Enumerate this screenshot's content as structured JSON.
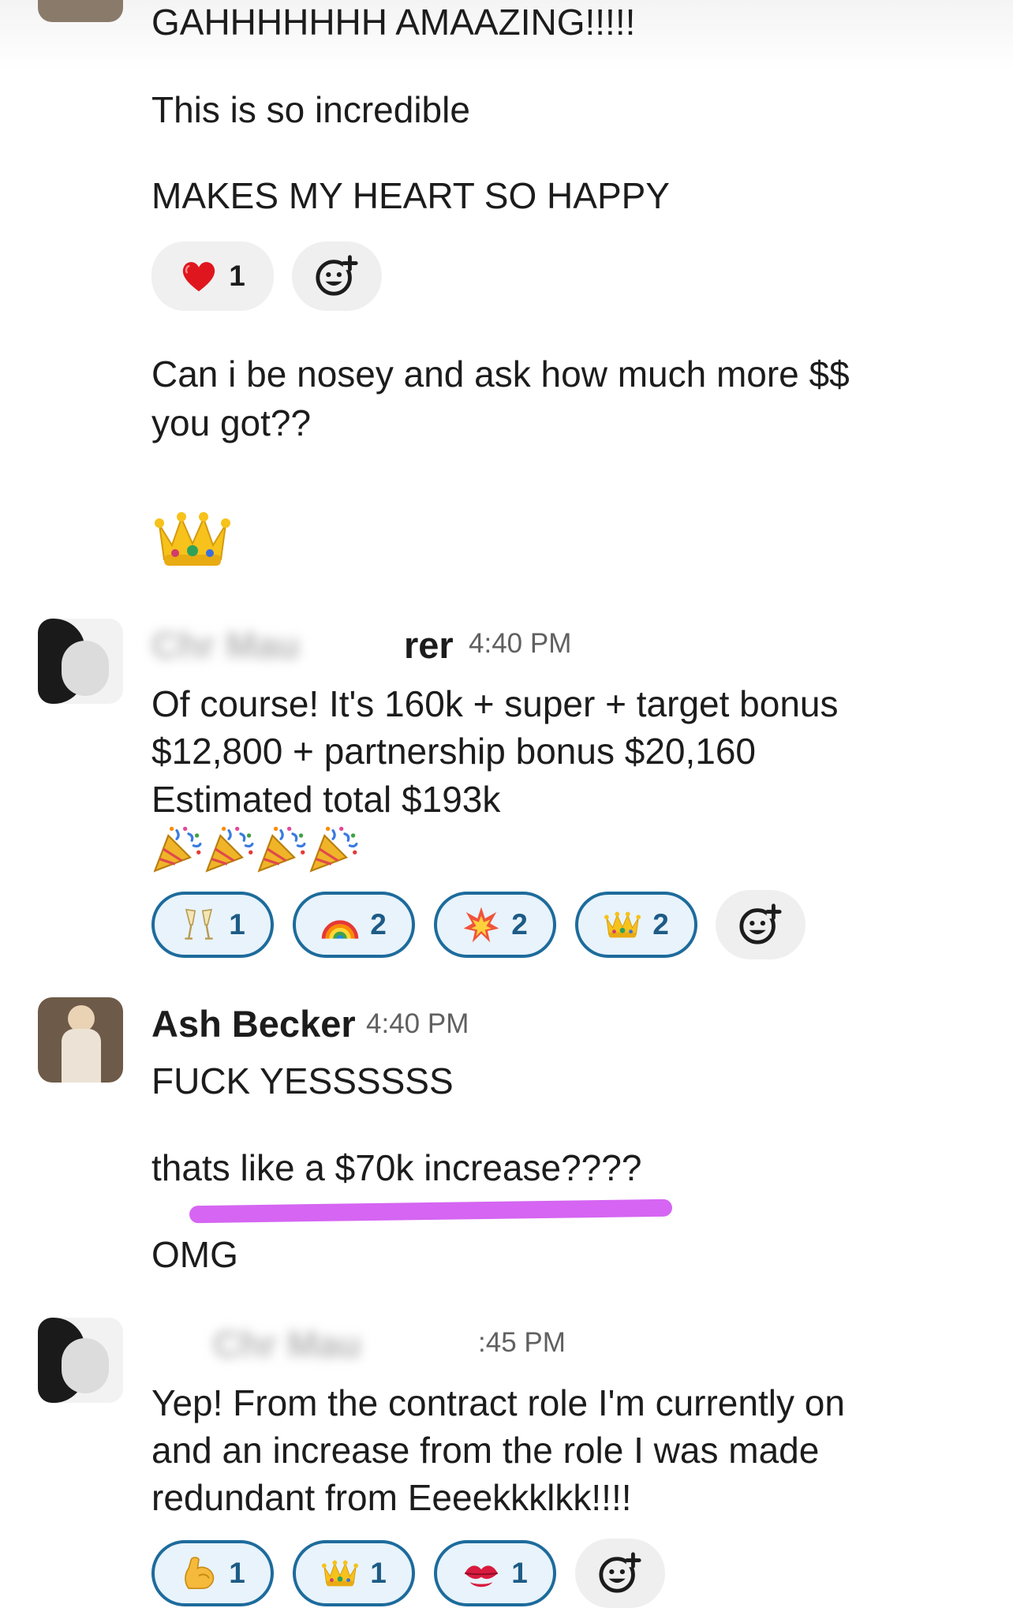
{
  "messages": {
    "m1": {
      "lines": [
        "GAHHHHHHH AMAAZING!!!!!",
        "This is so incredible",
        "MAKES MY HEART SO HAPPY"
      ],
      "reactions": [
        {
          "icon": "heart-icon",
          "count": "1",
          "selected": false
        }
      ]
    },
    "m2": {
      "lines": [
        "Can i be nosey and ask how much more $$",
        "you got??"
      ]
    },
    "m3": {
      "emoji": "crown-icon"
    },
    "m4": {
      "author_visible": "rer",
      "time": "4:40 PM",
      "lines": [
        "Of course! It's 160k + super + target bonus",
        "$12,800 + partnership bonus $20,160",
        "Estimated total $193k"
      ],
      "party_emojis": [
        "party-popper-icon",
        "party-popper-icon",
        "party-popper-icon",
        "party-popper-icon"
      ],
      "reactions": [
        {
          "icon": "champagne-glasses-icon",
          "count": "1",
          "selected": true
        },
        {
          "icon": "rainbow-icon",
          "count": "2",
          "selected": true
        },
        {
          "icon": "boom-icon",
          "count": "2",
          "selected": true
        },
        {
          "icon": "crown-icon",
          "count": "2",
          "selected": true
        }
      ]
    },
    "m5": {
      "author": "Ash Becker",
      "time": "4:40 PM",
      "lines": [
        "FUCK YESSSSSS",
        "thats like a $70k increase????",
        "OMG"
      ],
      "highlight_color": "#d060f0"
    },
    "m6": {
      "time_visible": ":45 PM",
      "lines": [
        "Yep! From the contract role I'm currently on",
        "and an increase from the role I was made",
        "redundant from Eeeekkklkk!!!!"
      ],
      "reactions": [
        {
          "icon": "flexed-biceps-icon",
          "count": "1",
          "selected": true
        },
        {
          "icon": "crown-icon",
          "count": "1",
          "selected": true
        },
        {
          "icon": "kiss-mark-icon",
          "count": "1",
          "selected": true
        }
      ]
    }
  },
  "colors": {
    "selected_border": "#1d6b9c",
    "selected_bg": "#e8f3fb",
    "plain_bg": "#f0f0f0"
  }
}
